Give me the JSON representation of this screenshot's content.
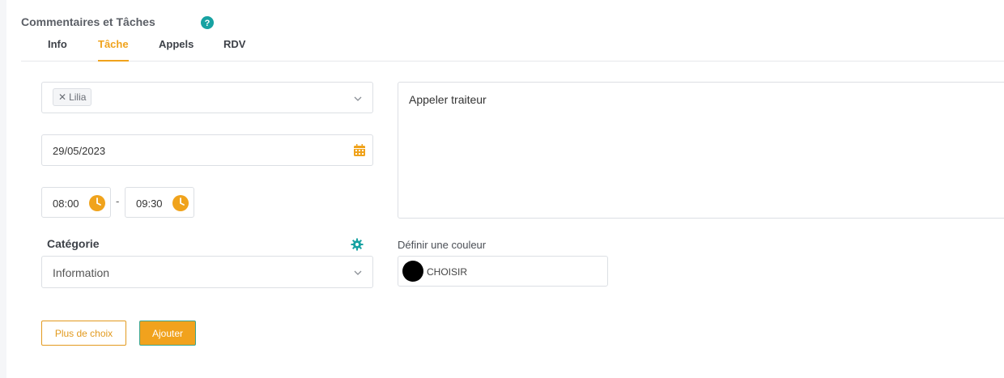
{
  "header": {
    "title": "Commentaires et Tâches",
    "help_icon": "question-circle-icon"
  },
  "tabs": [
    {
      "label": "Info",
      "active": false
    },
    {
      "label": "Tâche",
      "active": true
    },
    {
      "label": "Appels",
      "active": false
    },
    {
      "label": "RDV",
      "active": false
    }
  ],
  "task": {
    "assignees": [
      "Lilia"
    ],
    "date": "29/05/2023",
    "time_start": "08:00",
    "time_end": "09:30",
    "time_separator": "-",
    "comment": "Appeler traiteur",
    "category_label": "Catégorie",
    "category_value": "Information",
    "color_label": "Définir une couleur",
    "color_value": "#000000",
    "color_button": "CHOISIR"
  },
  "buttons": {
    "more": "Plus de choix",
    "add": "Ajouter"
  },
  "colors": {
    "accent": "#f0a31c",
    "teal": "#17a2a2",
    "border": "#dcdfe4"
  }
}
